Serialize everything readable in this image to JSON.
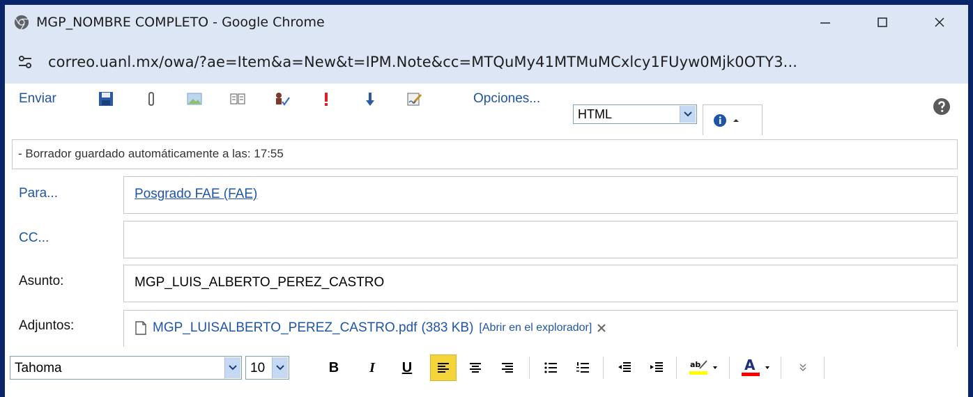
{
  "window": {
    "title": "MGP_NOMBRE COMPLETO - Google Chrome",
    "url": "correo.uanl.mx/owa/?ae=Item&a=New&t=IPM.Note&cc=MTQuMy41MTMuMCxlcy1FUyw0Mjk0OTY3..."
  },
  "toolbar": {
    "send_label": "Enviar",
    "options_label": "Opciones...",
    "format_value": "HTML",
    "icons": [
      "save-icon",
      "attach-icon",
      "image-icon",
      "address-book-icon",
      "check-names-icon",
      "importance-high-icon",
      "importance-low-icon",
      "signature-icon",
      "info-icon",
      "help-icon"
    ]
  },
  "status": {
    "text": "- Borrador guardado automáticamente a las: 17:55"
  },
  "fields": {
    "to_label": "Para...",
    "to_value": "Posgrado FAE (FAE)",
    "cc_label": "CC...",
    "cc_value": "",
    "subject_label": "Asunto:",
    "subject_value": "MGP_LUIS_ALBERTO_PEREZ_CASTRO",
    "attachments_label": "Adjuntos:",
    "attachment_name": "MGP_LUISALBERTO_PEREZ_CASTRO.pdf",
    "attachment_size": "(383 KB)",
    "attachment_open": "[Abrir en el explorador]"
  },
  "format_bar": {
    "font_value": "Tahoma",
    "size_value": "10",
    "bold": "B",
    "italic": "I",
    "underline": "U",
    "active_align": "left",
    "colors": {
      "highlight": "#ffff00",
      "font_color": "#ff0000",
      "active": "#f5d33b",
      "link": "#1f55a6"
    }
  }
}
